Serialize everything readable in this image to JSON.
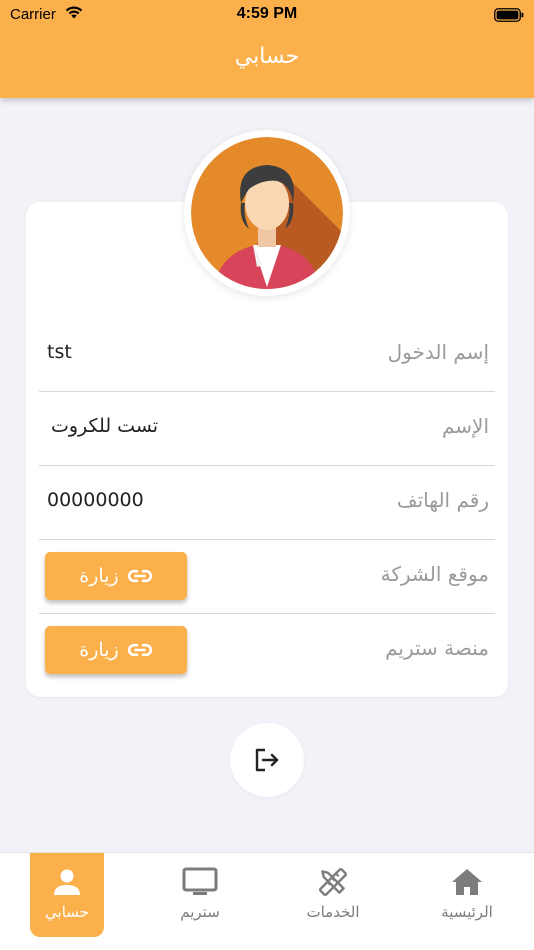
{
  "status_bar": {
    "carrier": "Carrier",
    "time": "4:59 PM"
  },
  "header": {
    "title": "حسابي"
  },
  "profile": {
    "avatar_icon": "user-avatar-icon",
    "rows": [
      {
        "label": "إسم الدخول",
        "value": "tst"
      },
      {
        "label": "الإسم",
        "value": "تست للكروت"
      },
      {
        "label": "رقم الهاتف",
        "value": "00000000"
      },
      {
        "label": "موقع الشركة",
        "button": "زيارة"
      },
      {
        "label": "منصة ستريم",
        "button": "زيارة"
      }
    ]
  },
  "logout": {
    "icon": "logout-icon"
  },
  "tabbar": {
    "tabs": [
      {
        "label": "حسابي",
        "icon": "person-icon",
        "active": true
      },
      {
        "label": "ستريم",
        "icon": "monitor-icon",
        "active": false
      },
      {
        "label": "الخدمات",
        "icon": "tools-icon",
        "active": false
      },
      {
        "label": "الرئيسية",
        "icon": "home-icon",
        "active": false
      }
    ]
  },
  "colors": {
    "accent": "#fbb04c",
    "background": "#f2f3f8",
    "label": "#9a9a9a",
    "inactive_tab": "#7c7c7c"
  }
}
